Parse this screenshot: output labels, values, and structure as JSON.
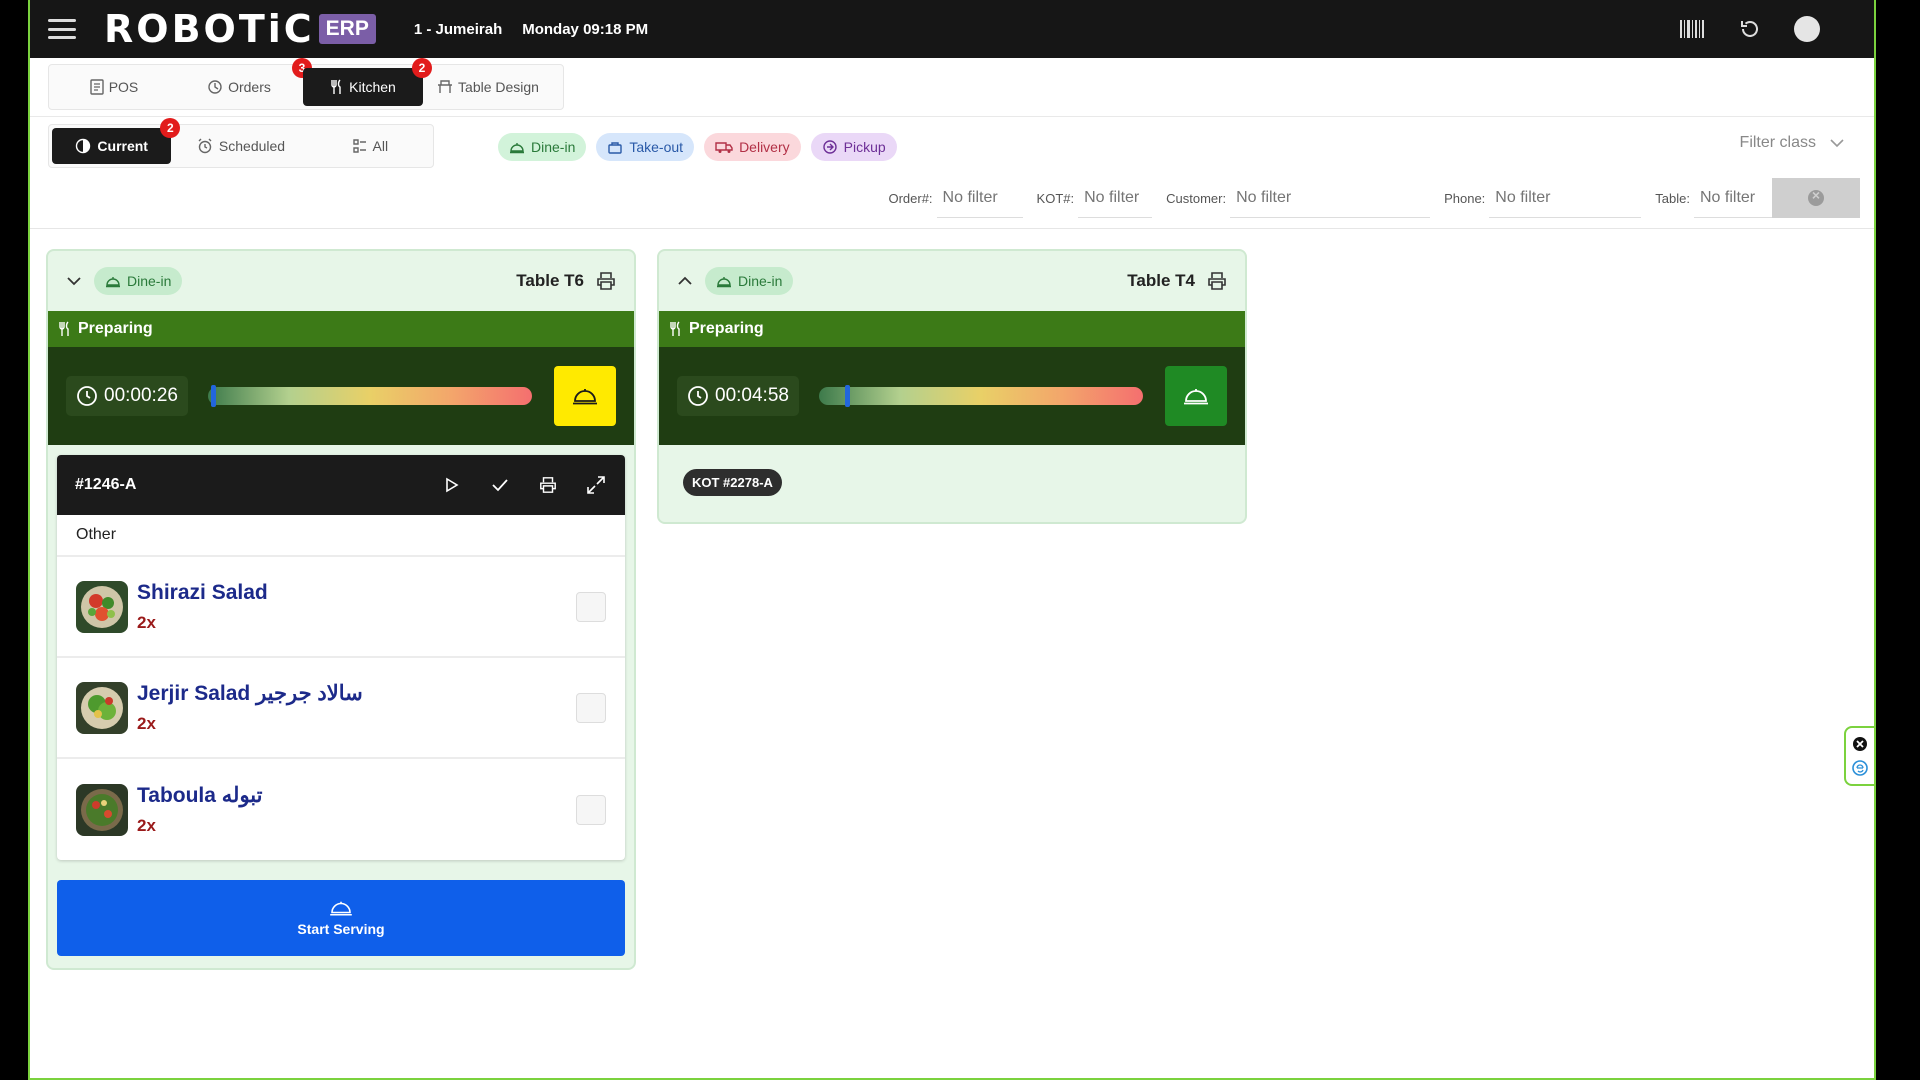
{
  "header": {
    "logo_text": "ROBOTiC",
    "logo_badge": "ERP",
    "branch": "1 - Jumeirah",
    "datetime": "Monday 09:18 PM"
  },
  "module_tabs": [
    {
      "label": "POS",
      "badge": ""
    },
    {
      "label": "Orders",
      "badge": "3"
    },
    {
      "label": "Kitchen",
      "badge": "2"
    },
    {
      "label": "Table Design",
      "badge": ""
    }
  ],
  "status_tabs": [
    {
      "label": "Current",
      "badge": "2"
    },
    {
      "label": "Scheduled",
      "badge": ""
    },
    {
      "label": "All",
      "badge": ""
    }
  ],
  "order_types": [
    "Dine-in",
    "Take-out",
    "Delivery",
    "Pickup"
  ],
  "filter_class": "Filter class",
  "filters": [
    {
      "label": "Order#:",
      "placeholder": "No filter"
    },
    {
      "label": "KOT#:",
      "placeholder": "No filter"
    },
    {
      "label": "Customer:",
      "placeholder": "No filter"
    },
    {
      "label": "Phone:",
      "placeholder": "No filter"
    },
    {
      "label": "Table:",
      "placeholder": "No filter"
    }
  ],
  "cards": [
    {
      "type": "Dine-in",
      "table": "Table T6",
      "status": "Preparing",
      "timer": "00:00:26",
      "progress": 0.01,
      "serve_color": "#ffea00",
      "kot": {
        "id": "#1246-A",
        "category": "Other",
        "items": [
          {
            "name": "Shirazi Salad",
            "qty": "2x"
          },
          {
            "name": "Jerjir Salad سالاد جرجير",
            "qty": "2x"
          },
          {
            "name": "Taboula تبوله",
            "qty": "2x"
          }
        ]
      },
      "action": "Start Serving"
    },
    {
      "type": "Dine-in",
      "table": "Table T4",
      "status": "Preparing",
      "timer": "00:04:58",
      "progress": 0.08,
      "serve_color": "#1f8a24",
      "kot_chip": "KOT #2278-A"
    }
  ],
  "colors": {
    "accent_green": "#3c7a17",
    "dark_green": "#1f3d12",
    "primary_blue": "#0f5fea",
    "badge_red": "#e21c1c"
  }
}
